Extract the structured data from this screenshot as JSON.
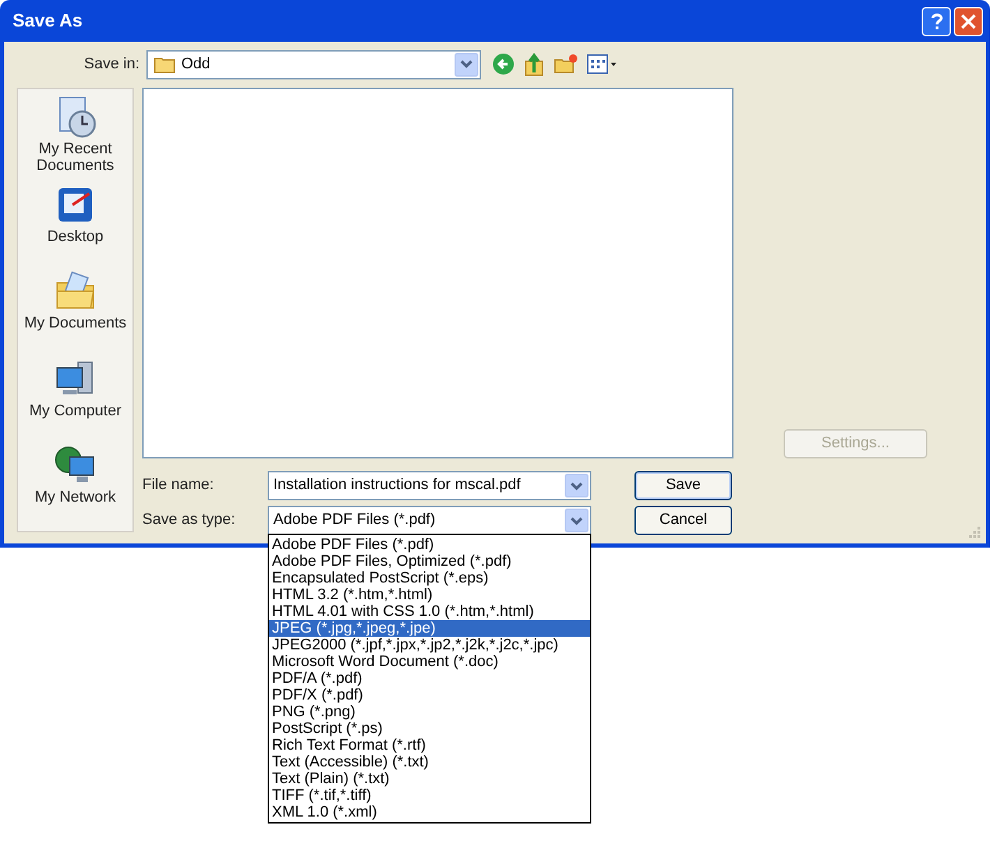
{
  "window": {
    "title": "Save As"
  },
  "save_in": {
    "label": "Save in:",
    "value": "Odd"
  },
  "places": [
    {
      "label": "My Recent Documents"
    },
    {
      "label": "Desktop"
    },
    {
      "label": "My Documents"
    },
    {
      "label": "My Computer"
    },
    {
      "label": "My Network"
    }
  ],
  "settings_button": {
    "label": "Settings...",
    "disabled": true
  },
  "file_name": {
    "label": "File name:",
    "value": "Installation instructions for mscal.pdf"
  },
  "save_as_type": {
    "label": "Save as type:",
    "value": "Adobe PDF Files (*.pdf)",
    "expanded": true
  },
  "buttons": [
    "Save",
    "Cancel"
  ],
  "type_options": [
    {
      "label": "Adobe PDF Files (*.pdf)",
      "selected": false
    },
    {
      "label": "Adobe PDF Files, Optimized (*.pdf)",
      "selected": false
    },
    {
      "label": "Encapsulated PostScript (*.eps)",
      "selected": false
    },
    {
      "label": "HTML 3.2 (*.htm,*.html)",
      "selected": false
    },
    {
      "label": "HTML 4.01 with CSS 1.0 (*.htm,*.html)",
      "selected": false
    },
    {
      "label": "JPEG (*.jpg,*.jpeg,*.jpe)",
      "selected": true
    },
    {
      "label": "JPEG2000 (*.jpf,*.jpx,*.jp2,*.j2k,*.j2c,*.jpc)",
      "selected": false
    },
    {
      "label": "Microsoft Word Document (*.doc)",
      "selected": false
    },
    {
      "label": "PDF/A (*.pdf)",
      "selected": false
    },
    {
      "label": "PDF/X (*.pdf)",
      "selected": false
    },
    {
      "label": "PNG (*.png)",
      "selected": false
    },
    {
      "label": "PostScript (*.ps)",
      "selected": false
    },
    {
      "label": "Rich Text Format (*.rtf)",
      "selected": false
    },
    {
      "label": "Text (Accessible) (*.txt)",
      "selected": false
    },
    {
      "label": "Text (Plain) (*.txt)",
      "selected": false
    },
    {
      "label": "TIFF (*.tif,*.tiff)",
      "selected": false
    },
    {
      "label": "XML 1.0 (*.xml)",
      "selected": false
    }
  ]
}
